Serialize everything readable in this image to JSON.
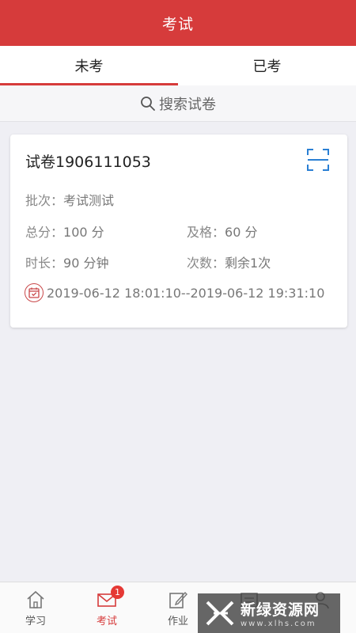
{
  "header": {
    "title": "考试"
  },
  "tabs": [
    {
      "label": "未考",
      "active": true
    },
    {
      "label": "已考",
      "active": false
    }
  ],
  "search": {
    "placeholder": "搜索试卷"
  },
  "exam_card": {
    "title": "试卷1906111053",
    "batch_label": "批次：",
    "batch_value": "考试测试",
    "total_label": "总分：",
    "total_value": "100 分",
    "pass_label": "及格：",
    "pass_value": "60 分",
    "duration_label": "时长：",
    "duration_value": "90 分钟",
    "attempts_label": "次数：",
    "attempts_value": "剩余1次",
    "time_range": "2019-06-12 18:01:10--2019-06-12 19:31:10"
  },
  "bottom_nav": [
    {
      "label": "学习",
      "icon": "home-icon"
    },
    {
      "label": "考试",
      "icon": "mail-icon",
      "badge": "1",
      "active": true
    },
    {
      "label": "作业",
      "icon": "edit-icon"
    },
    {
      "label": "",
      "icon": "list-icon"
    },
    {
      "label": "",
      "icon": "user-icon"
    }
  ],
  "watermark": {
    "main": "新绿资源网",
    "sub": "www.xlhs.com"
  },
  "colors": {
    "primary": "#d63b3b",
    "scan": "#2a7fd4",
    "background": "#efeff4"
  }
}
